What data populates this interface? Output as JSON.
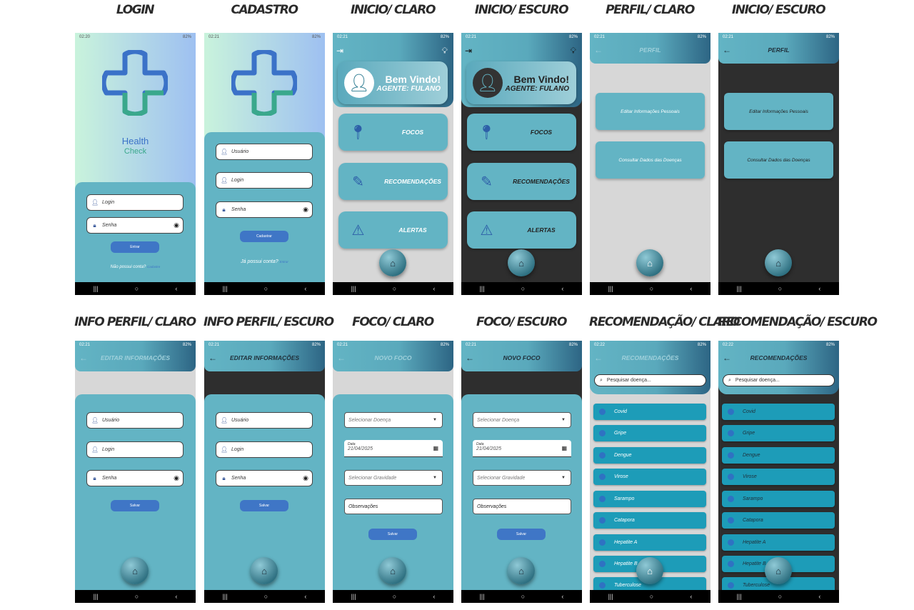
{
  "status": {
    "battery": "82%",
    "icons": "▲ ⚡ ▾"
  },
  "nav": {
    "recent": "|||",
    "home": "○",
    "back": "‹"
  },
  "captions": [
    "LOGIN",
    "CADASTRO",
    "INICIO/ CLARO",
    "INICIO/ ESCURO",
    "PERFIL/ CLARO",
    "INICIO/ ESCURO",
    "INFO PERFIL/ CLARO",
    "INFO PERFIL/ ESCURO",
    "FOCO/ CLARO",
    "FOCO/ ESCURO",
    "RECOMENDAÇÃO/ CLARO",
    "RECOMENDAÇÃO/ ESCURO"
  ],
  "times": [
    "02:20",
    "02:21",
    "02:21",
    "02:21",
    "02:21",
    "02:21",
    "02:21",
    "02:21",
    "02:21",
    "02:21",
    "02:22",
    "02:22"
  ],
  "login": {
    "app_name_1": "Health",
    "app_name_2": "Check",
    "login_placeholder": "Login",
    "password_placeholder": "Senha",
    "enter_button": "Entrar",
    "no_account": "Não possui conta?",
    "register_link": "Cadastre"
  },
  "cadastro": {
    "user_placeholder": "Usuário",
    "login_placeholder": "Login",
    "password_placeholder": "Senha",
    "register_button": "Cadastrar",
    "has_account": "Já possui conta?",
    "enter_link": "Entrar"
  },
  "inicio": {
    "welcome": "Bem Vindo!",
    "agent": "AGENTE: FULANO",
    "cards": [
      "FOCOS",
      "RECOMENDAÇÕES",
      "ALERTAS"
    ]
  },
  "perfil": {
    "title": "PERFIL",
    "options": [
      "Editar Informações Pessoais",
      "Consultar Dados das Doenças"
    ]
  },
  "info": {
    "title": "EDITAR INFORMAÇÕES",
    "fields": [
      "Usuário",
      "Login",
      "Senha"
    ],
    "save_button": "Salvar"
  },
  "foco": {
    "title": "NOVO FOCO",
    "disease_placeholder": "Selecionar Doença",
    "date_label": "Data",
    "date_value": "21/04/2025",
    "severity_placeholder": "Selecionar Gravidade",
    "notes_placeholder": "Observações",
    "save_button": "Salvar"
  },
  "recomendacao": {
    "title": "RECOMENDAÇÕES",
    "search_placeholder": "Pesquisar doença...",
    "diseases": [
      "Covid",
      "Gripe",
      "Dengue",
      "Virose",
      "Sarampo",
      "Catapora",
      "Hepatite A",
      "Hepatite B",
      "Tuberculose"
    ]
  },
  "colors": {
    "accent": "#63b4c4",
    "button": "#3f76c6",
    "light_bg": "#d7d7d7",
    "dark_bg": "#2e2e2e",
    "list_item": "#1d9cb8"
  }
}
